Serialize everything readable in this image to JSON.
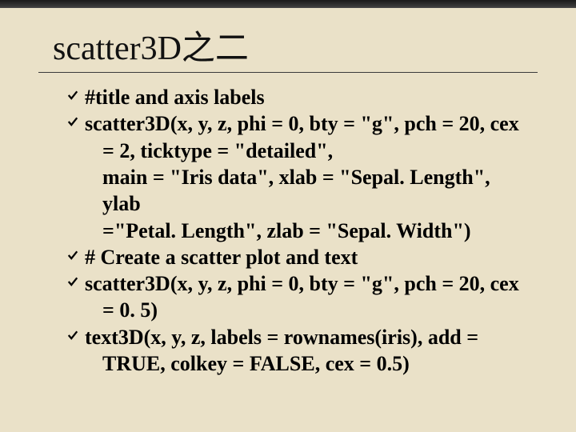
{
  "title": "scatter3D之二",
  "lines": [
    {
      "bullet": true,
      "indent": false,
      "text": "#title and axis labels"
    },
    {
      "bullet": true,
      "indent": false,
      "text": "scatter3D(x, y, z, phi = 0, bty = \"g\", pch = 20, cex"
    },
    {
      "bullet": false,
      "indent": true,
      "text": "= 2, ticktype = \"detailed\","
    },
    {
      "bullet": false,
      "indent": true,
      "text": "main = \"Iris data\", xlab = \"Sepal. Length\", ylab"
    },
    {
      "bullet": false,
      "indent": true,
      "text": "=\"Petal. Length\", zlab = \"Sepal. Width\")"
    },
    {
      "bullet": true,
      "indent": false,
      "text": "# Create a scatter plot and text"
    },
    {
      "bullet": true,
      "indent": false,
      "text": "scatter3D(x, y, z, phi = 0, bty = \"g\", pch = 20, cex"
    },
    {
      "bullet": false,
      "indent": true,
      "text": "= 0. 5)"
    },
    {
      "bullet": true,
      "indent": false,
      "text": "text3D(x, y, z,  labels = rownames(iris), add ="
    },
    {
      "bullet": false,
      "indent": true,
      "text": "TRUE, colkey = FALSE, cex = 0.5)"
    }
  ]
}
